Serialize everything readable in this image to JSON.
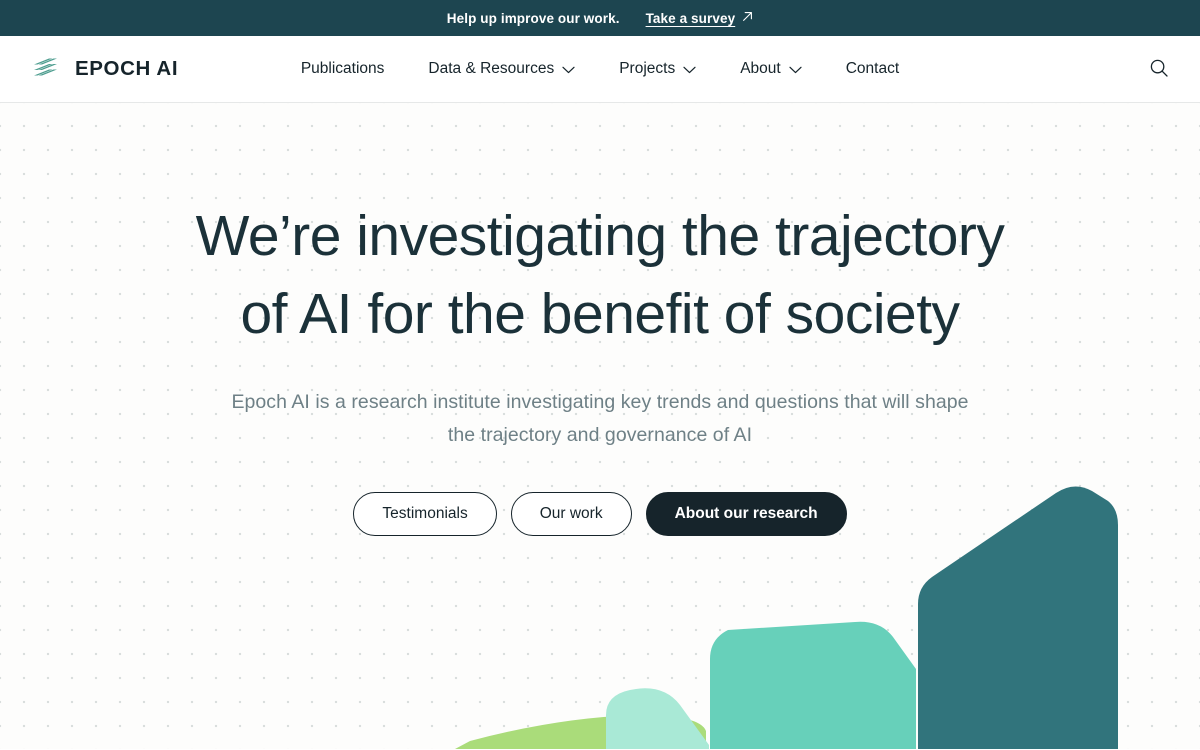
{
  "banner": {
    "message": "Help up improve our work.",
    "link_label": "Take a survey",
    "arrow_icon": "arrow-up-right-icon",
    "background_color": "#1d4550"
  },
  "header": {
    "logo": {
      "text": "EPOCH AI",
      "mark_icon": "epoch-logo-mark",
      "mark_color": "#4f9e90"
    },
    "nav_items": [
      {
        "label": "Publications",
        "has_dropdown": false
      },
      {
        "label": "Data & Resources",
        "has_dropdown": true
      },
      {
        "label": "Projects",
        "has_dropdown": true
      },
      {
        "label": "About",
        "has_dropdown": true
      },
      {
        "label": "Contact",
        "has_dropdown": false
      }
    ],
    "search_icon": "search-icon"
  },
  "hero": {
    "headline_line1": "We’re investigating the trajectory",
    "headline_line2": "of AI for the benefit of society",
    "subtitle_line1": "Epoch AI is a research institute investigating key trends and questions that will shape",
    "subtitle_line2": "the trajectory and governance of AI",
    "buttons": [
      {
        "label": "Testimonials",
        "style": "outline"
      },
      {
        "label": "Our work",
        "style": "outline"
      },
      {
        "label": "About our research",
        "style": "solid"
      }
    ],
    "headline_color": "#1b3139",
    "subtitle_color": "#6e8086",
    "background_color": "#fdfdfc",
    "dot_color": "#d9dedd"
  },
  "decoration": {
    "shapes": [
      {
        "name": "lime-bar",
        "color": "#aadc7a"
      },
      {
        "name": "mint-bar",
        "color": "#a9e9d6"
      },
      {
        "name": "green-bar",
        "color": "#67d0ba"
      },
      {
        "name": "teal-bar",
        "color": "#31747c"
      }
    ]
  }
}
